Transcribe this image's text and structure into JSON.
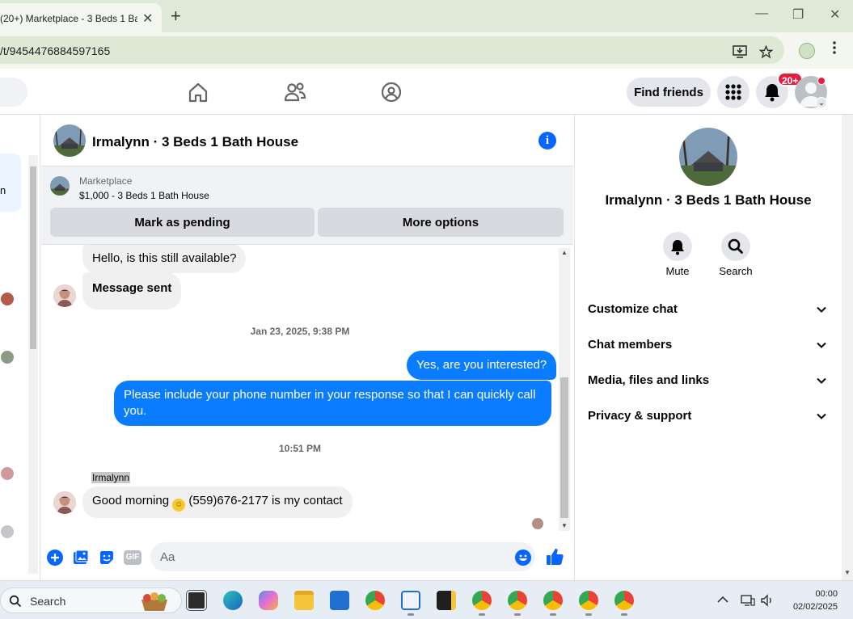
{
  "browser": {
    "tab_title": "(20+) Marketplace - 3 Beds 1 Ba",
    "close_tab": "✕",
    "new_tab": "+",
    "url": "/t/9454476884597165",
    "win_minimize": "—",
    "win_restore": "❐",
    "win_close": "✕"
  },
  "fbnav": {
    "find_friends": "Find friends",
    "notification_badge": "20+",
    "profile_chevron": "⌄"
  },
  "sidebar": {
    "cutoff_letter": "n"
  },
  "chat": {
    "title": "Irmalynn · 3 Beds 1 Bath House",
    "info": "i",
    "marketplace_label": "Marketplace",
    "listing": "$1,000 - 3 Beds 1 Bath House",
    "mark_pending": "Mark as pending",
    "more_options": "More options",
    "messages": [
      {
        "text": "Hello, is this still available?"
      },
      {
        "text": "Message sent"
      },
      {
        "text": "Yes, are you interested?"
      },
      {
        "text": "Please include your phone number in your response so that I can quickly call you."
      },
      {
        "text_before": "Good morning ",
        "emoji": "☺",
        "text_after": " (559)676-2177 is my contact"
      }
    ],
    "timestamps": [
      "Jan 23, 2025, 9:38 PM",
      "10:51 PM"
    ],
    "sender_name": "Irmalynn",
    "composer_placeholder": "Aa",
    "gif_label": "GIF"
  },
  "details": {
    "name": "Irmalynn · 3 Beds 1 Bath House",
    "mute_label": "Mute",
    "search_label": "Search",
    "sections": [
      {
        "label": "Customize chat"
      },
      {
        "label": "Chat members"
      },
      {
        "label": "Media, files and links"
      },
      {
        "label": "Privacy & support"
      }
    ]
  },
  "taskbar": {
    "search_placeholder": "Search",
    "time": "00:00",
    "date": "02/02/2025"
  },
  "colors": {
    "messenger_blue": "#0a7cff",
    "fb_blue": "#0866ff",
    "badge_red": "#e41e3f"
  }
}
